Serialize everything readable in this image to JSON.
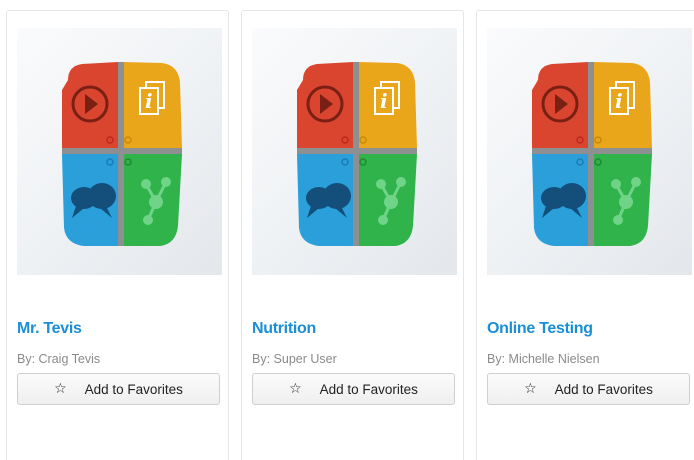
{
  "cards": [
    {
      "title": "Mr. Tevis",
      "author": "By: Craig Tevis",
      "favorite_label": "Add to Favorites",
      "icon": "star-outline-icon",
      "thumbnail": "tile-app-logo"
    },
    {
      "title": "Nutrition",
      "author": "By: Super User",
      "favorite_label": "Add to Favorites",
      "icon": "star-outline-icon",
      "thumbnail": "tile-app-logo"
    },
    {
      "title": "Online Testing",
      "author": "By: Michelle Nielsen",
      "favorite_label": "Add to Favorites",
      "icon": "star-outline-icon",
      "thumbnail": "tile-app-logo"
    }
  ],
  "colors": {
    "title_link": "#1a8fd6",
    "tile_red": "#d9452f",
    "tile_yellow": "#eaa61a",
    "tile_blue": "#2b9fd9",
    "tile_green": "#2fb34a"
  }
}
